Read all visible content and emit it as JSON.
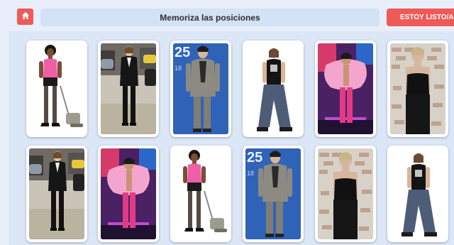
{
  "header": {
    "home_icon": "home-icon",
    "title": "Memoriza las posiciones",
    "ready_button": "ESTOY LISTO/A"
  },
  "colors": {
    "accent": "#ee5a57",
    "background": "#dbe6f6",
    "title_bar": "#d3e2f5"
  },
  "cards": [
    {
      "image": "man-pink-top-vacuum"
    },
    {
      "image": "woman-black-suit-street"
    },
    {
      "image": "man-gray-suit-blue-backdrop"
    },
    {
      "image": "woman-baggy-jeans-white"
    },
    {
      "image": "man-pink-fur-stage"
    },
    {
      "image": "woman-black-top-brick-wall"
    },
    {
      "image": "woman-black-suit-street"
    },
    {
      "image": "man-pink-fur-stage"
    },
    {
      "image": "man-pink-top-vacuum"
    },
    {
      "image": "man-gray-suit-blue-backdrop"
    },
    {
      "image": "woman-black-top-brick-wall"
    },
    {
      "image": "woman-baggy-jeans-white"
    }
  ]
}
